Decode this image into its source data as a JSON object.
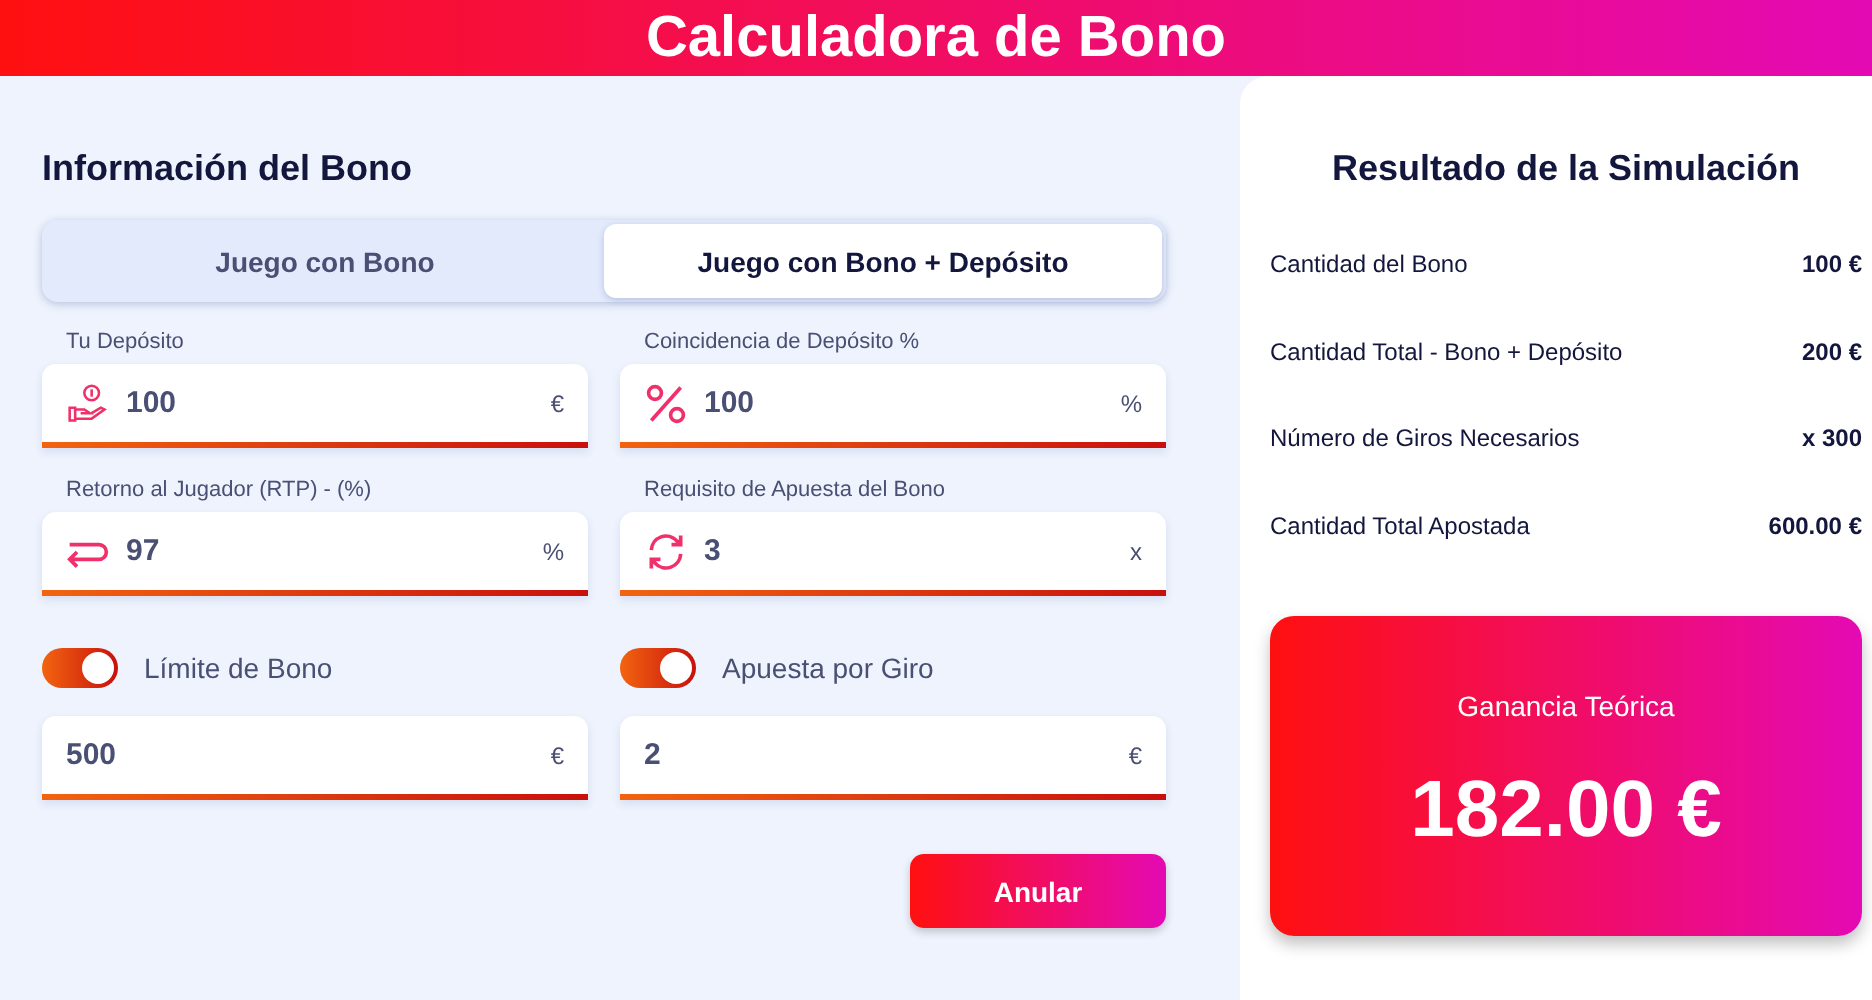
{
  "header": {
    "title": "Calculadora de Bono"
  },
  "form": {
    "title": "Información del Bono",
    "tabs": [
      {
        "label": "Juego con Bono",
        "selected": false
      },
      {
        "label": "Juego con Bono + Depósito",
        "selected": true
      }
    ],
    "fields": [
      {
        "label": "Tu Depósito",
        "value": "100",
        "unit": "€"
      },
      {
        "label": "Coincidencia de Depósito %",
        "value": "100",
        "unit": "%"
      },
      {
        "label": "Retorno al Jugador (RTP) - (%)",
        "value": "97",
        "unit": "%"
      },
      {
        "label": "Requisito de Apuesta del Bono",
        "value": "3",
        "unit": "x"
      }
    ],
    "toggles": [
      {
        "label": "Límite de Bono",
        "on": true,
        "value": "500",
        "unit": "€"
      },
      {
        "label": "Apuesta por Giro",
        "on": true,
        "value": "2",
        "unit": "€"
      }
    ],
    "cancel_button": "Anular"
  },
  "results": {
    "title": "Resultado de la Simulación",
    "rows": [
      {
        "label": "Cantidad del Bono",
        "value": "100 €"
      },
      {
        "label": "Cantidad Total - Bono + Depósito",
        "value": "200 €"
      },
      {
        "label": "Número de Giros Necesarios",
        "value": "x 300"
      },
      {
        "label": "Cantidad Total Apostada",
        "value": "600.00 €"
      }
    ],
    "profit_label": "Ganancia Teórica",
    "profit_value": "182.00 €"
  }
}
